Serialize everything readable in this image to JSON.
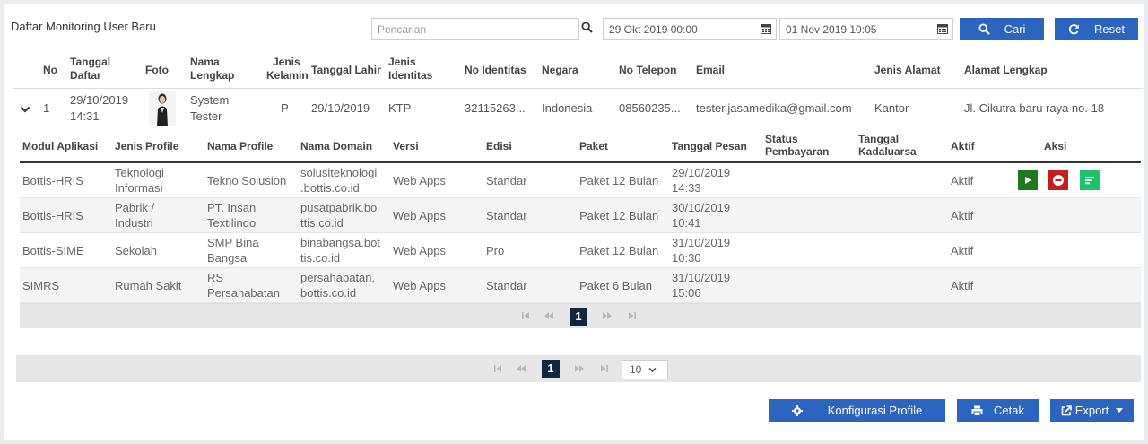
{
  "page": {
    "title": "Daftar Monitoring User Baru"
  },
  "filters": {
    "search_placeholder": "Pencarian",
    "date_from": "29 Okt 2019 00:00",
    "date_to": "01 Nov 2019 10:05",
    "search_button": "Cari",
    "reset_button": "Reset"
  },
  "main_table": {
    "headers": {
      "no": "No",
      "tanggal_daftar": [
        "Tanggal",
        "Daftar"
      ],
      "foto": "Foto",
      "nama_lengkap": [
        "Nama",
        "Lengkap"
      ],
      "jenis_kelamin": [
        "Jenis",
        "Kelamin"
      ],
      "tanggal_lahir": "Tanggal Lahir",
      "jenis_identitas": [
        "Jenis",
        "Identitas"
      ],
      "no_identitas": "No Identitas",
      "negara": "Negara",
      "no_telepon": "No Telepon",
      "email": "Email",
      "jenis_alamat": "Jenis Alamat",
      "alamat_lengkap": "Alamat Lengkap"
    },
    "row": {
      "no": "1",
      "tanggal_daftar": [
        "29/10/2019",
        "14:31"
      ],
      "nama_lengkap": [
        "System",
        "Tester"
      ],
      "jenis_kelamin": "P",
      "tanggal_lahir": "29/10/2019",
      "jenis_identitas": "KTP",
      "no_identitas": "32115263...",
      "negara": "Indonesia",
      "no_telepon": "08560235...",
      "email": "tester.jasamedika@gmail.com",
      "jenis_alamat": "Kantor",
      "alamat_lengkap": "Jl. Cikutra baru raya no. 18"
    }
  },
  "detail_table": {
    "headers": {
      "modul": "Modul Aplikasi",
      "jenis_profile": "Jenis Profile",
      "nama_profile": "Nama Profile",
      "nama_domain": "Nama Domain",
      "versi": "Versi",
      "edisi": "Edisi",
      "paket": "Paket",
      "tanggal_pesan": "Tanggal Pesan",
      "status_pembayaran": [
        "Status",
        "Pembayaran"
      ],
      "tanggal_kadaluarsa": [
        "Tanggal",
        "Kadaluarsa"
      ],
      "aktif": "Aktif",
      "aksi": "Aksi"
    },
    "rows": [
      {
        "modul": "Bottis-HRIS",
        "jenis_profile": [
          "Teknologi",
          "Informasi"
        ],
        "nama_profile": [
          "Tekno Solusion",
          ""
        ],
        "nama_domain": [
          "solusiteknologi",
          ".bottis.co.id"
        ],
        "versi": "Web Apps",
        "edisi": "Standar",
        "paket": "Paket 12 Bulan",
        "tanggal_pesan": [
          "29/10/2019",
          "14:33"
        ],
        "aktif": "Aktif"
      },
      {
        "modul": "Bottis-HRIS",
        "jenis_profile": [
          "Pabrik /",
          "Industri"
        ],
        "nama_profile": [
          "PT. Insan",
          "Textilindo"
        ],
        "nama_domain": [
          "pusatpabrik.bo",
          "ttis.co.id"
        ],
        "versi": "Web Apps",
        "edisi": "Standar",
        "paket": "Paket 12 Bulan",
        "tanggal_pesan": [
          "30/10/2019",
          "10:41"
        ],
        "aktif": "Aktif"
      },
      {
        "modul": "Bottis-SIME",
        "jenis_profile": [
          "Sekolah",
          ""
        ],
        "nama_profile": [
          "SMP Bina",
          "Bangsa"
        ],
        "nama_domain": [
          "binabangsa.bot",
          "tis.co.id"
        ],
        "versi": "Web Apps",
        "edisi": "Pro",
        "paket": "Paket 12 Bulan",
        "tanggal_pesan": [
          "31/10/2019",
          "10:30"
        ],
        "aktif": "Aktif"
      },
      {
        "modul": "SIMRS",
        "jenis_profile": [
          "Rumah Sakit",
          ""
        ],
        "nama_profile": [
          "RS",
          "Persahabatan"
        ],
        "nama_domain": [
          "persahabatan.",
          "bottis.co.id"
        ],
        "versi": "Web Apps",
        "edisi": "Standar",
        "paket": "Paket 6 Bulan",
        "tanggal_pesan": [
          "31/10/2019",
          "15:06"
        ],
        "aktif": "Aktif"
      }
    ],
    "pager_page": "1"
  },
  "outer_pager": {
    "page": "1",
    "page_size": "10"
  },
  "footer": {
    "konfigurasi": "Konfigurasi Profile",
    "cetak": "Cetak",
    "export": "Export"
  },
  "colors": {
    "primary": "#2b65bf",
    "play": "#1f7a1f",
    "stop": "#c41e1e",
    "list": "#1ec26b",
    "pager_active": "#13263f"
  },
  "icons": [
    "search-icon",
    "calendar-icon",
    "refresh-icon",
    "chevron-down-icon",
    "play-icon",
    "stop-icon",
    "list-icon",
    "gear-icon",
    "print-icon",
    "external-link-icon",
    "caret-down-icon"
  ]
}
